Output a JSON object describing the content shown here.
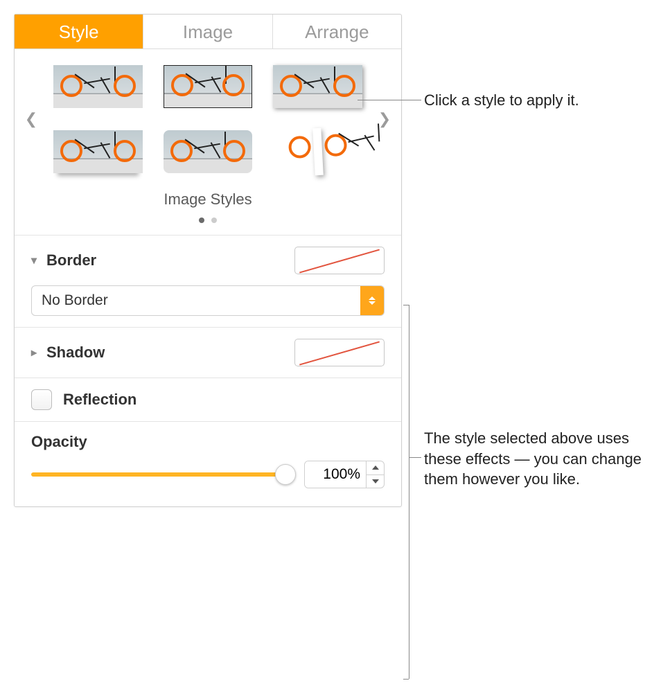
{
  "tabs": {
    "style": "Style",
    "image": "Image",
    "arrange": "Arrange"
  },
  "styles_section": {
    "caption": "Image Styles"
  },
  "border": {
    "label": "Border",
    "select_value": "No Border"
  },
  "shadow": {
    "label": "Shadow"
  },
  "reflection": {
    "label": "Reflection",
    "checked": false
  },
  "opacity": {
    "label": "Opacity",
    "value_text": "100%",
    "value": 100
  },
  "callouts": {
    "styles": "Click a style to apply it.",
    "effects": "The style selected above uses these effects — you can change them however you like."
  }
}
